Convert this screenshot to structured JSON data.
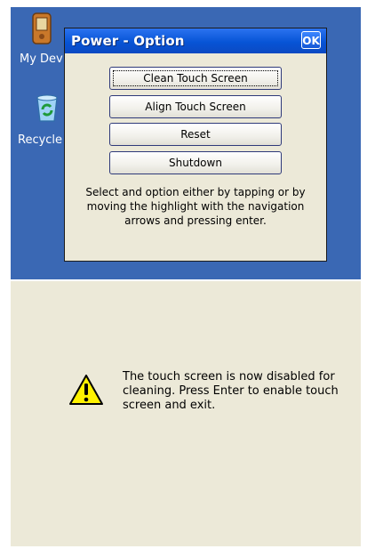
{
  "desktop": {
    "icons": [
      {
        "label": "My Dev"
      },
      {
        "label": "Recycle"
      }
    ]
  },
  "dialog": {
    "title": "Power - Option",
    "ok_label": "OK",
    "buttons": [
      {
        "label": "Clean Touch Screen",
        "focused": true
      },
      {
        "label": "Align Touch Screen",
        "focused": false
      },
      {
        "label": "Reset",
        "focused": false
      },
      {
        "label": "Shutdown",
        "focused": false
      }
    ],
    "instructions": "Select and option either by tapping or by moving the highlight with the navigation arrows and pressing enter."
  },
  "notice": {
    "message": "The touch screen is now disabled for cleaning.  Press Enter to enable touch screen and exit.",
    "icon": "warning-icon"
  },
  "colors": {
    "desktop": "#3a68b4",
    "titlebar": "#0754d6",
    "dialog_bg": "#ece9d8"
  }
}
